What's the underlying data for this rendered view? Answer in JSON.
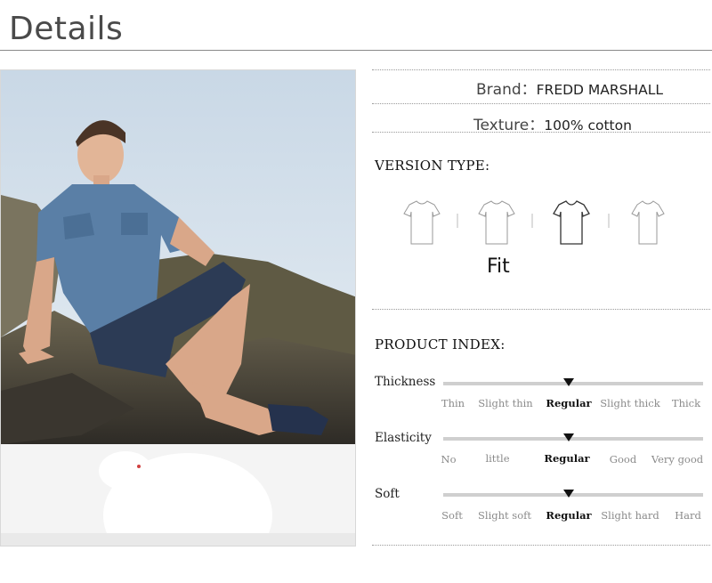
{
  "header": {
    "title": "Details"
  },
  "specs": {
    "brand_label": "Brand：",
    "brand_value": "FREDD MARSHALL",
    "texture_label": "Texture：",
    "texture_value": "100% cotton"
  },
  "version": {
    "title": "VERSION TYPE:",
    "fit_label": "Fit",
    "shirt_icons": [
      "tshirt-icon",
      "tshirt-icon",
      "tshirt-icon",
      "tshirt-icon"
    ],
    "selected_index": 2
  },
  "product_index": {
    "title": "PRODUCT INDEX:",
    "rows": [
      {
        "label": "Thickness",
        "options": [
          "Thin",
          "Slight thin",
          "Regular",
          "Slight thick",
          "Thick"
        ],
        "selected": 2
      },
      {
        "label": "Elasticity",
        "options": [
          "No",
          "little",
          "Regular",
          "Good",
          "Very good"
        ],
        "selected": 2
      },
      {
        "label": "Soft",
        "options": [
          "Soft",
          "Slight soft",
          "Regular",
          "Slight hard",
          "Hard"
        ],
        "selected": 2
      }
    ]
  },
  "colors": {
    "rule": "#8a8a8a",
    "bar": "#cfcfcf",
    "marker": "#111111",
    "muted": "#8a8a8a"
  }
}
